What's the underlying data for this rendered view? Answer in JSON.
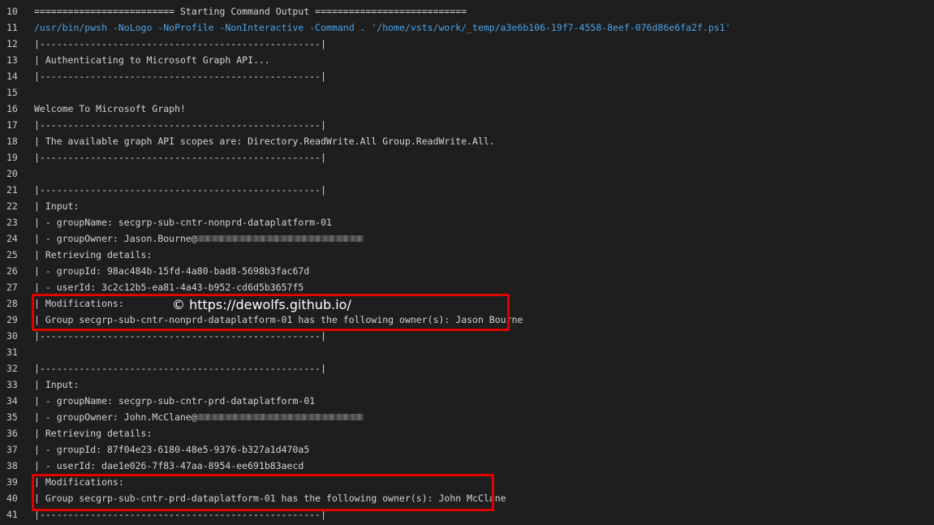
{
  "log": {
    "lines": [
      {
        "n": "10",
        "text": "========================= Starting Command Output ==========================="
      },
      {
        "n": "11",
        "text": "/usr/bin/pwsh -NoLogo -NoProfile -NonInteractive -Command . '/home/vsts/work/_temp/a3e6b106-19f7-4558-8eef-076d86e6fa2f.ps1'"
      },
      {
        "n": "12",
        "text": "|--------------------------------------------------|"
      },
      {
        "n": "13",
        "text": "| Authenticating to Microsoft Graph API..."
      },
      {
        "n": "14",
        "text": "|--------------------------------------------------|"
      },
      {
        "n": "15",
        "text": ""
      },
      {
        "n": "16",
        "text": "Welcome To Microsoft Graph!"
      },
      {
        "n": "17",
        "text": "|--------------------------------------------------|"
      },
      {
        "n": "18",
        "text": "| The available graph API scopes are: Directory.ReadWrite.All Group.ReadWrite.All."
      },
      {
        "n": "19",
        "text": "|--------------------------------------------------|"
      },
      {
        "n": "20",
        "text": ""
      },
      {
        "n": "21",
        "text": "|--------------------------------------------------|"
      },
      {
        "n": "22",
        "text": "| Input:"
      },
      {
        "n": "23",
        "text": "| - groupName: secgrp-sub-cntr-nonprd-dataplatform-01"
      },
      {
        "n": "24",
        "text": "| - groupOwner: Jason.Bourne@"
      },
      {
        "n": "25",
        "text": "| Retrieving details:"
      },
      {
        "n": "26",
        "text": "| - groupId: 98ac484b-15fd-4a80-bad8-5698b3fac67d"
      },
      {
        "n": "27",
        "text": "| - userId: 3c2c12b5-ea81-4a43-b952-cd6d5b3657f5"
      },
      {
        "n": "28",
        "text": "| Modifications:"
      },
      {
        "n": "29",
        "text": "| Group secgrp-sub-cntr-nonprd-dataplatform-01 has the following owner(s): Jason Bourne"
      },
      {
        "n": "30",
        "text": "|--------------------------------------------------|"
      },
      {
        "n": "31",
        "text": ""
      },
      {
        "n": "32",
        "text": "|--------------------------------------------------|"
      },
      {
        "n": "33",
        "text": "| Input:"
      },
      {
        "n": "34",
        "text": "| - groupName: secgrp-sub-cntr-prd-dataplatform-01"
      },
      {
        "n": "35",
        "text": "| - groupOwner: John.McClane@"
      },
      {
        "n": "36",
        "text": "| Retrieving details:"
      },
      {
        "n": "37",
        "text": "| - groupId: 87f04e23-6180-48e5-9376-b327a1d470a5"
      },
      {
        "n": "38",
        "text": "| - userId: dae1e026-7f83-47aa-8954-ee691b83aecd"
      },
      {
        "n": "39",
        "text": "| Modifications:"
      },
      {
        "n": "40",
        "text": "| Group secgrp-sub-cntr-prd-dataplatform-01 has the following owner(s): John McClane"
      },
      {
        "n": "41",
        "text": "|--------------------------------------------------|"
      }
    ]
  },
  "watermark": {
    "text": "© https://dewolfs.github.io/"
  },
  "colors": {
    "background": "#1e1e1e",
    "text": "#d4d4d4",
    "command": "#4aa3e8",
    "highlight_border": "#e00000"
  }
}
